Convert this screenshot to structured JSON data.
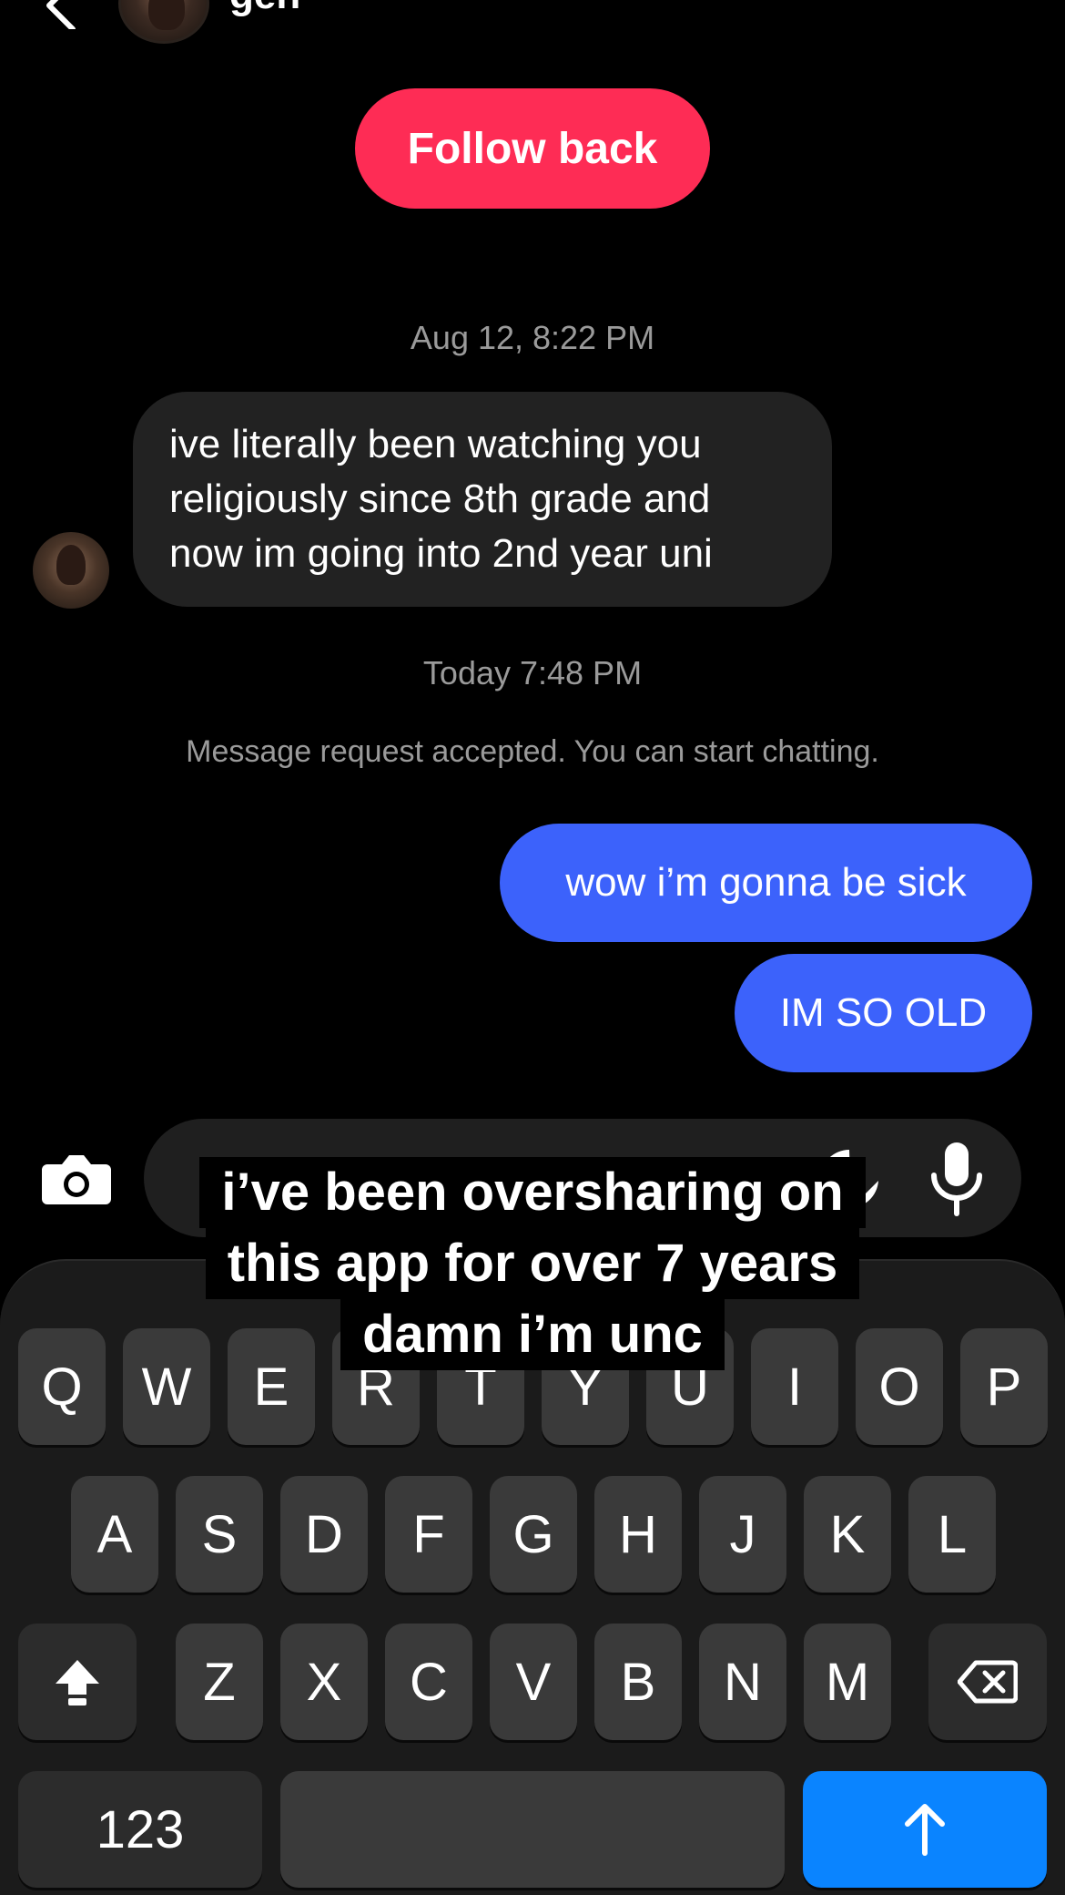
{
  "header": {
    "contact_name": "gen"
  },
  "follow_back_label": "Follow back",
  "timestamps": [
    "Aug 12, 8:22 PM",
    "Today 7:48 PM"
  ],
  "incoming_message": "ive literally been watching you\nreligiously  since 8th grade and\nnow im going into 2nd year uni",
  "system_message": "Message request accepted. You can start chatting.",
  "outgoing_messages": [
    "wow i’m gonna be sick",
    "IM SO OLD"
  ],
  "caption_lines": [
    "i’ve been oversharing on",
    "this app for over 7 years",
    "damn i’m unc"
  ],
  "keyboard": {
    "row1": [
      "Q",
      "W",
      "E",
      "R",
      "T",
      "Y",
      "U",
      "I",
      "O",
      "P"
    ],
    "row2": [
      "A",
      "S",
      "D",
      "F",
      "G",
      "H",
      "J",
      "K",
      "L"
    ],
    "row3": [
      "Z",
      "X",
      "C",
      "V",
      "B",
      "N",
      "M"
    ],
    "numbers_label": "123"
  },
  "colors": {
    "follow_back": "#fe2c55",
    "outgoing_bubble": "#3c62fb",
    "incoming_bubble": "#222222",
    "send_key": "#0a84ff"
  }
}
